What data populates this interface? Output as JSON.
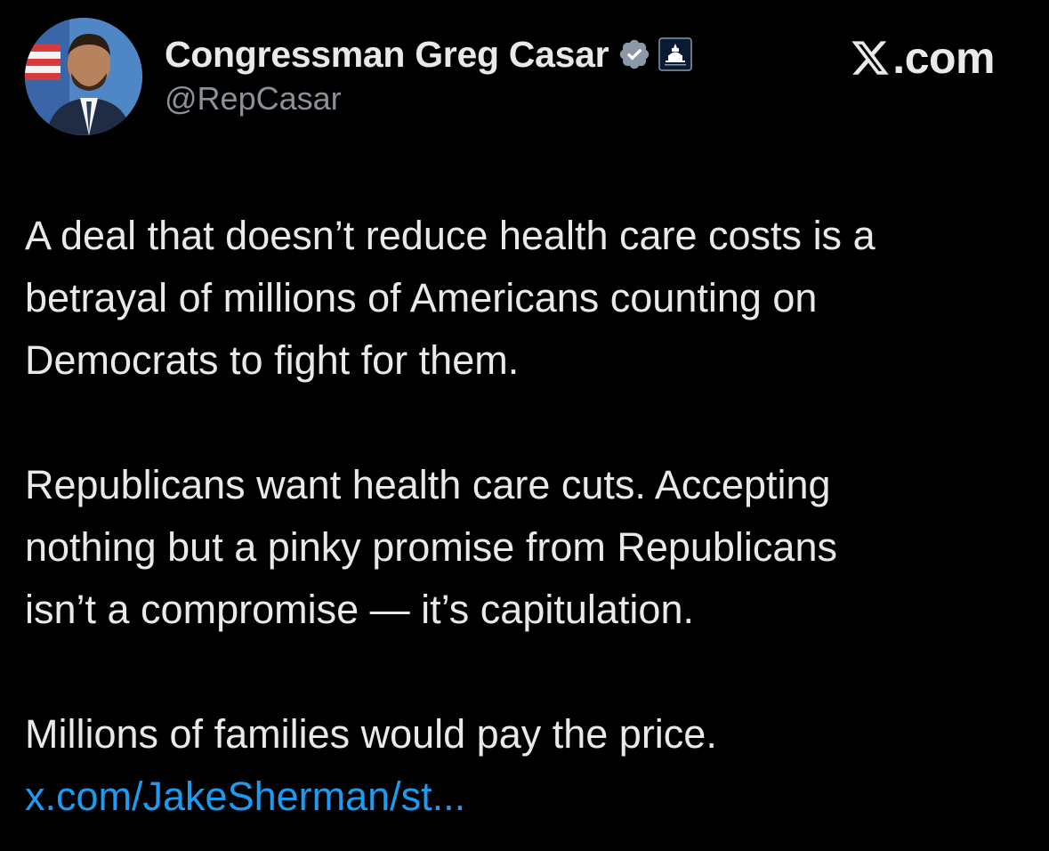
{
  "author": {
    "display_name": "Congressman Greg Casar",
    "handle": "@RepCasar",
    "avatar_icon": "profile-photo",
    "verified_icon": "verified-badge-icon",
    "affiliate_icon": "house-democrats-capitol-icon"
  },
  "brand": {
    "logo_text": ".com",
    "logo_icon": "x-logo-icon"
  },
  "tweet": {
    "paragraphs": [
      "A deal that doesn’t reduce health care costs is a\nbetrayal of millions of Americans counting on\nDemocrats to fight for them.",
      "Republicans want health care cuts. Accepting\nnothing but a pinky promise from Republicans\nisn’t a compromise — it’s capitulation.",
      "Millions of families would pay the price."
    ],
    "link_text": "x.com/JakeSherman/st..."
  },
  "colors": {
    "background": "#000000",
    "text": "#e7e9ea",
    "secondary_text": "#8b9198",
    "link": "#1d9bf0",
    "verified": "#8b98a5"
  }
}
